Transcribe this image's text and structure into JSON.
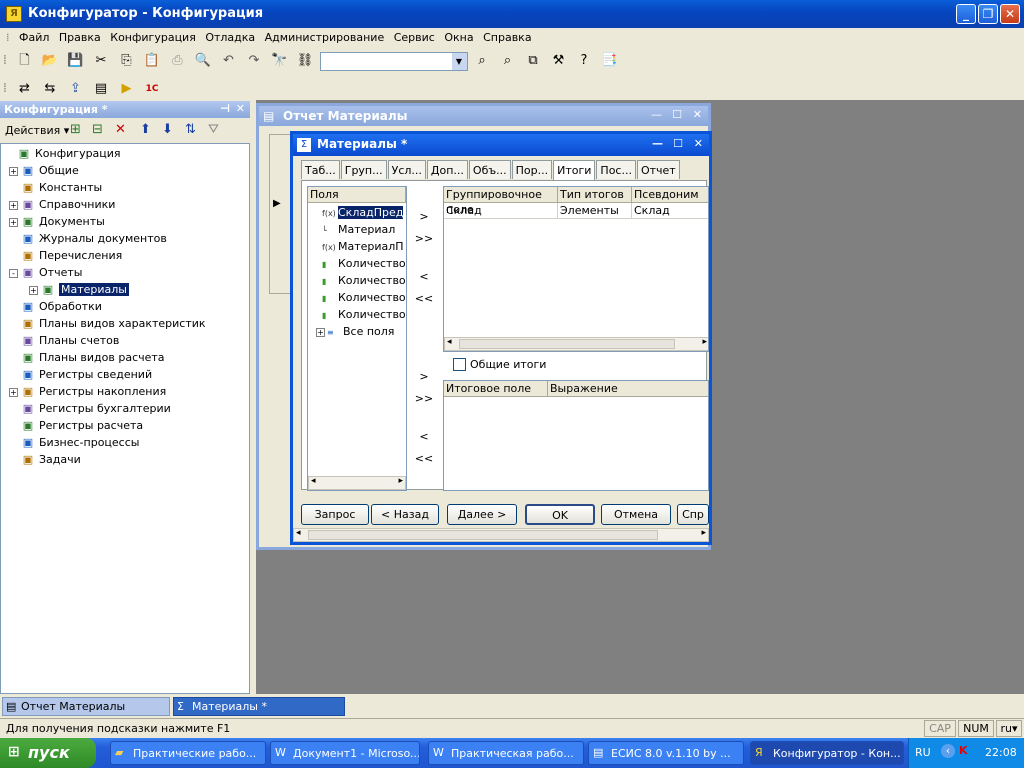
{
  "window": {
    "title": "Конфигуратор - Конфигурация"
  },
  "menu": [
    "Файл",
    "Правка",
    "Конфигурация",
    "Отладка",
    "Администрирование",
    "Сервис",
    "Окна",
    "Справка"
  ],
  "search": {
    "value": ""
  },
  "config_panel": {
    "title": "Конфигурация *",
    "actions_label": "Действия"
  },
  "tree": [
    {
      "label": "Конфигурация",
      "icon": "config-icon",
      "level": 0,
      "pm": ""
    },
    {
      "label": "Общие",
      "icon": "common-icon",
      "level": 1,
      "pm": "+"
    },
    {
      "label": "Константы",
      "icon": "constants-icon",
      "level": 1,
      "pm": ""
    },
    {
      "label": "Справочники",
      "icon": "catalogs-icon",
      "level": 1,
      "pm": "+"
    },
    {
      "label": "Документы",
      "icon": "documents-icon",
      "level": 1,
      "pm": "+"
    },
    {
      "label": "Журналы документов",
      "icon": "journals-icon",
      "level": 1,
      "pm": ""
    },
    {
      "label": "Перечисления",
      "icon": "enums-icon",
      "level": 1,
      "pm": ""
    },
    {
      "label": "Отчеты",
      "icon": "reports-icon",
      "level": 1,
      "pm": "-"
    },
    {
      "label": "Материалы",
      "icon": "report-icon",
      "level": 2,
      "pm": "+",
      "selected": true
    },
    {
      "label": "Обработки",
      "icon": "processing-icon",
      "level": 1,
      "pm": ""
    },
    {
      "label": "Планы видов характеристик",
      "icon": "chart-types-icon",
      "level": 1,
      "pm": ""
    },
    {
      "label": "Планы счетов",
      "icon": "accounts-icon",
      "level": 1,
      "pm": ""
    },
    {
      "label": "Планы видов расчета",
      "icon": "calc-types-icon",
      "level": 1,
      "pm": ""
    },
    {
      "label": "Регистры сведений",
      "icon": "info-registers-icon",
      "level": 1,
      "pm": ""
    },
    {
      "label": "Регистры накопления",
      "icon": "accum-registers-icon",
      "level": 1,
      "pm": "+"
    },
    {
      "label": "Регистры бухгалтерии",
      "icon": "acct-registers-icon",
      "level": 1,
      "pm": ""
    },
    {
      "label": "Регистры расчета",
      "icon": "calc-registers-icon",
      "level": 1,
      "pm": ""
    },
    {
      "label": "Бизнес-процессы",
      "icon": "business-process-icon",
      "level": 1,
      "pm": ""
    },
    {
      "label": "Задачи",
      "icon": "tasks-icon",
      "level": 1,
      "pm": ""
    }
  ],
  "report_window": {
    "title": "Отчет Материалы"
  },
  "dialog": {
    "title": "Материалы *",
    "tabs": [
      "Таб...",
      "Груп...",
      "Усл...",
      "Доп...",
      "Объ...",
      "Пор...",
      "Итоги",
      "Пос...",
      "Отчет"
    ],
    "fields_header": "Поля",
    "fields": [
      {
        "label": "СкладПред",
        "icon": "f(x)",
        "selected": true
      },
      {
        "label": "Материал",
        "icon": "└"
      },
      {
        "label": "МатериалП",
        "icon": "f(x)"
      },
      {
        "label": "Количество",
        "icon": "▮"
      },
      {
        "label": "Количество",
        "icon": "▮"
      },
      {
        "label": "Количество",
        "icon": "▮"
      },
      {
        "label": "Количество",
        "icon": "▮"
      },
      {
        "label": "Все поля",
        "icon": "≡",
        "pm": "+"
      }
    ],
    "group_table": {
      "headers": [
        "Группировочное поле",
        "Тип итогов",
        "Псевдоним"
      ],
      "rows": [
        [
          "Склад",
          "Элементы",
          "Склад"
        ]
      ]
    },
    "common_totals_label": "Общие итоги",
    "totals_table": {
      "headers": [
        "Итоговое поле",
        "Выражение"
      ]
    },
    "arrows": {
      "add": ">",
      "add_all": ">>",
      "remove": "<",
      "remove_all": "<<"
    },
    "buttons": {
      "query": "Запрос",
      "back": "< Назад",
      "next": "Далее >",
      "ok": "OK",
      "cancel": "Отмена",
      "help": "Спр"
    }
  },
  "doc_tabs": [
    "Отчет Материалы",
    "Материалы *"
  ],
  "status": {
    "hint": "Для получения подсказки нажмите F1",
    "cap": "CAP",
    "num": "NUM",
    "lang": "ru"
  },
  "taskbar": {
    "start_label": "пуск",
    "tasks": [
      "Практические рабо...",
      "Документ1 - Microso...",
      "Практическая рабо...",
      "ЕСИС 8.0 v.1.10 by ...",
      "Конфигуратор - Кон..."
    ],
    "tray_lang": "RU",
    "clock": "22:08"
  }
}
